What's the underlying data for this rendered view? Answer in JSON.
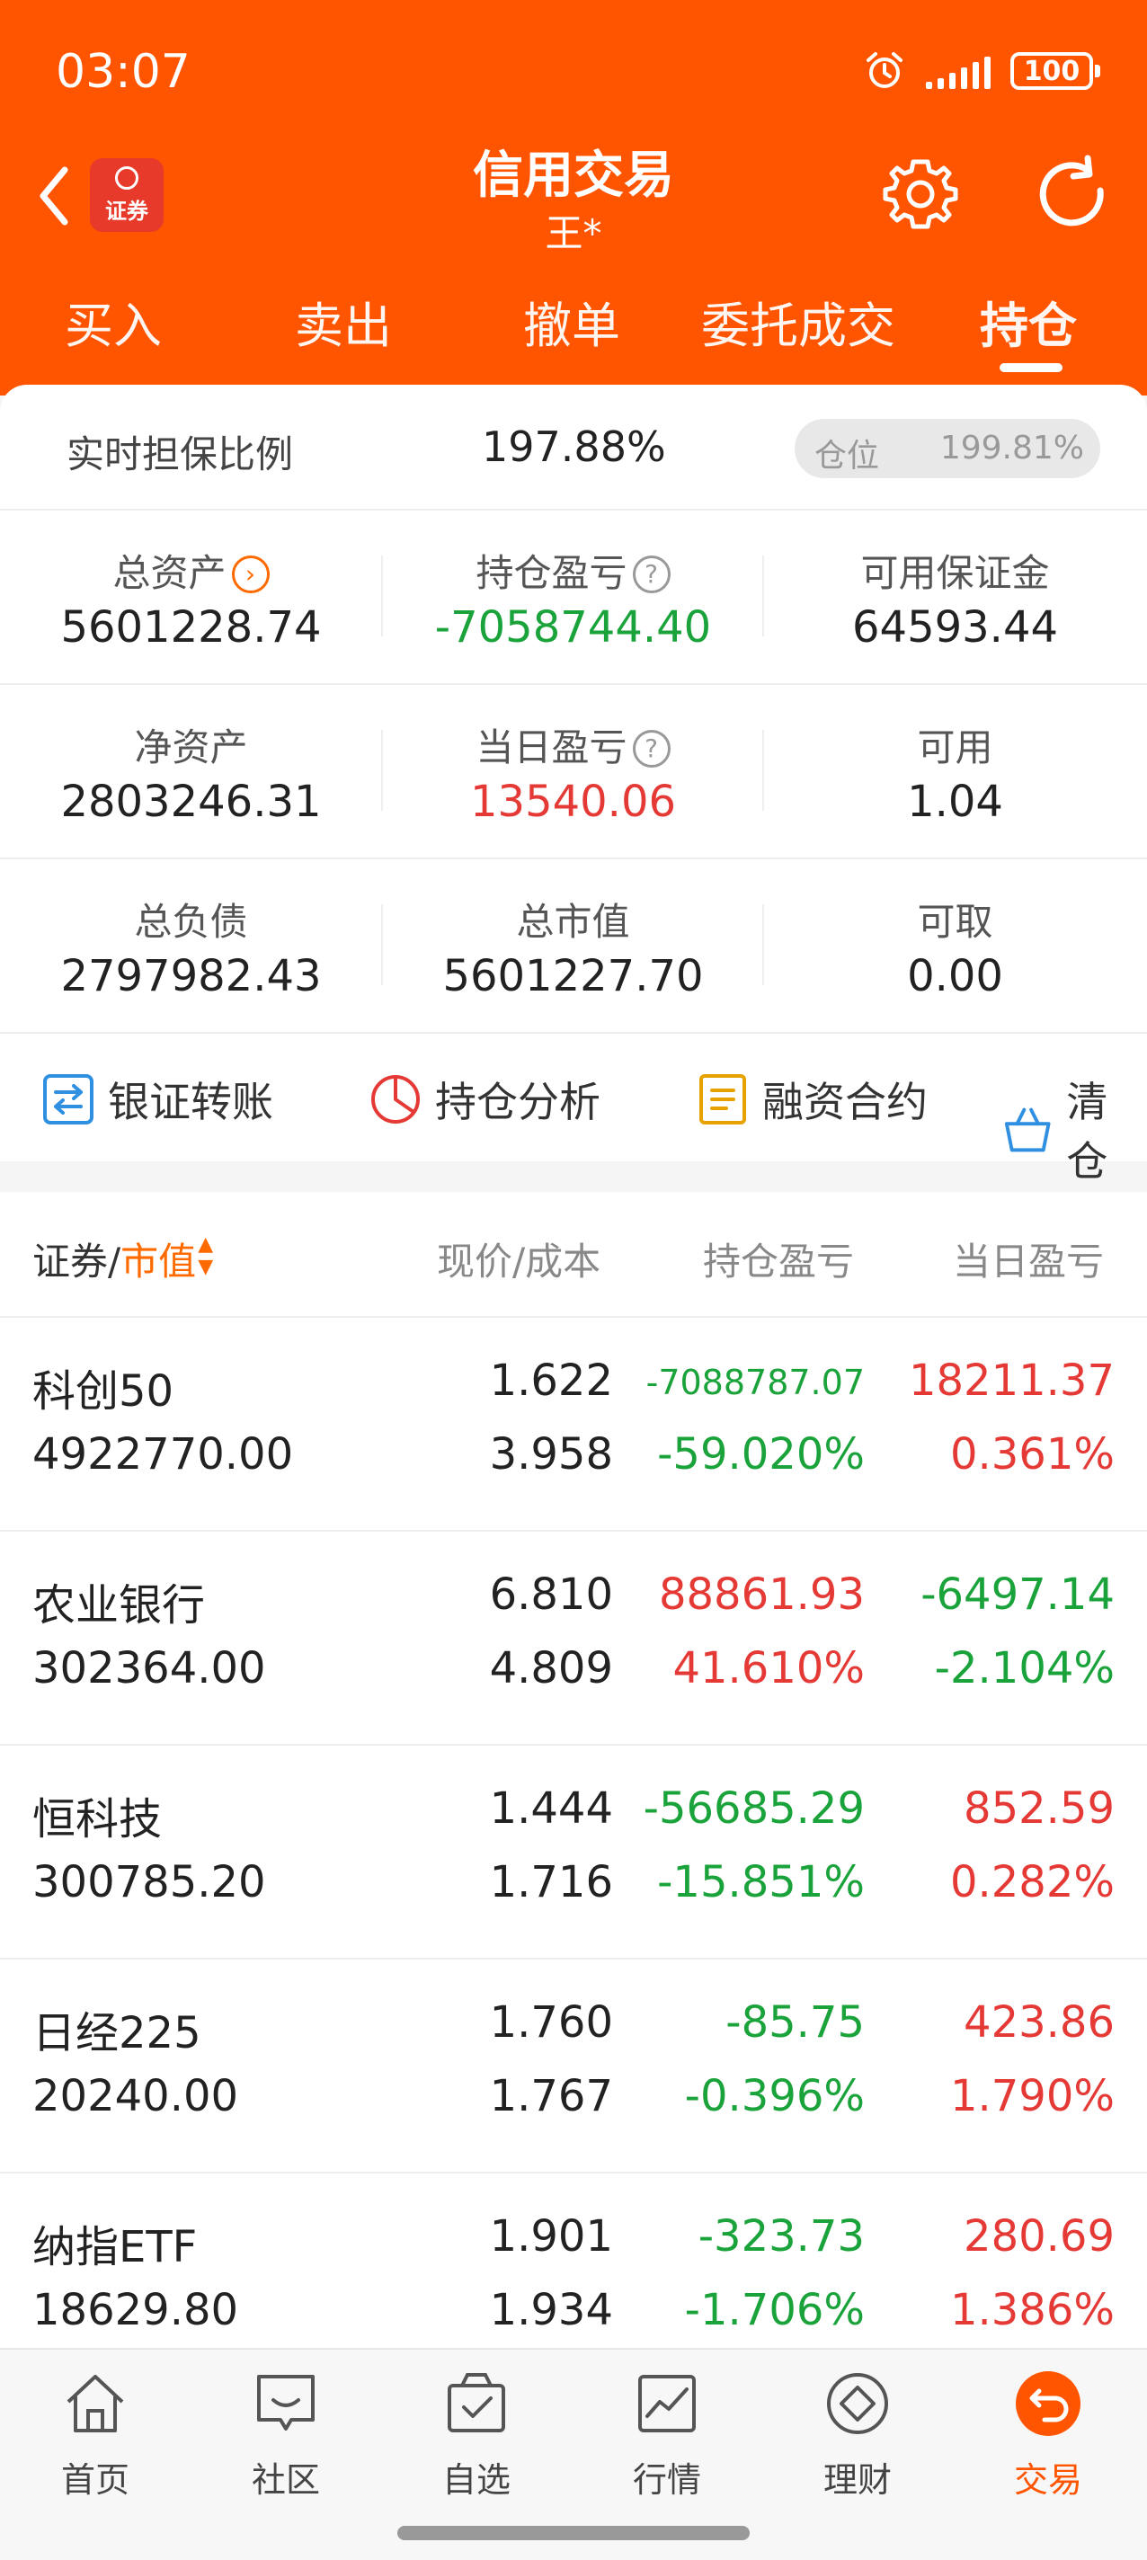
{
  "status": {
    "time": "03:07",
    "battery": "100"
  },
  "header": {
    "brand_label": "证券",
    "title": "信用交易",
    "subtitle": "王*"
  },
  "tabs": [
    {
      "label": "买入"
    },
    {
      "label": "卖出"
    },
    {
      "label": "撤单"
    },
    {
      "label": "委托成交"
    },
    {
      "label": "持仓"
    }
  ],
  "active_tab": "持仓",
  "ratio": {
    "label": "实时担保比例",
    "value": "197.88%",
    "position_label": "仓位",
    "position_value": "199.81%"
  },
  "metrics": [
    [
      {
        "label": "总资产",
        "value": "5601228.74"
      },
      {
        "label": "持仓盈亏",
        "value": "-7058744.40"
      },
      {
        "label": "可用保证金",
        "value": "64593.44"
      }
    ],
    [
      {
        "label": "净资产",
        "value": "2803246.31"
      },
      {
        "label": "当日盈亏",
        "value": "13540.06"
      },
      {
        "label": "可用",
        "value": "1.04"
      }
    ],
    [
      {
        "label": "总负债",
        "value": "2797982.43"
      },
      {
        "label": "总市值",
        "value": "5601227.70"
      },
      {
        "label": "可取",
        "value": "0.00"
      }
    ]
  ],
  "actions": [
    {
      "label": "银证转账"
    },
    {
      "label": "持仓分析"
    },
    {
      "label": "融资合约"
    },
    {
      "label": "清仓"
    }
  ],
  "table": {
    "headers": {
      "security": "证券",
      "slash": "/",
      "market_value": "市值",
      "price_cost": "现价/成本",
      "pl": "持仓盈亏",
      "day_pl": "当日盈亏"
    },
    "rows": [
      {
        "name": "科创50",
        "market_value": "4922770.00",
        "price": "1.622",
        "cost": "3.958",
        "pl": "-7088787.07",
        "pl_pct": "-59.020%",
        "day": "18211.37",
        "day_pct": "0.361%"
      },
      {
        "name": "农业银行",
        "market_value": "302364.00",
        "price": "6.810",
        "cost": "4.809",
        "pl": "88861.93",
        "pl_pct": "41.610%",
        "day": "-6497.14",
        "day_pct": "-2.104%"
      },
      {
        "name": "恒科技",
        "market_value": "300785.20",
        "price": "1.444",
        "cost": "1.716",
        "pl": "-56685.29",
        "pl_pct": "-15.851%",
        "day": "852.59",
        "day_pct": "0.282%"
      },
      {
        "name": "日经225",
        "market_value": "20240.00",
        "price": "1.760",
        "cost": "1.767",
        "pl": "-85.75",
        "pl_pct": "-0.396%",
        "day": "423.86",
        "day_pct": "1.790%"
      },
      {
        "name": "纳指ETF",
        "market_value": "18629.80",
        "price": "1.901",
        "cost": "1.934",
        "pl": "-323.73",
        "pl_pct": "-1.706%",
        "day": "280.69",
        "day_pct": "1.386%"
      }
    ]
  },
  "bottom_nav": [
    {
      "label": "首页",
      "icon": "home-icon"
    },
    {
      "label": "社区",
      "icon": "chat-icon"
    },
    {
      "label": "自选",
      "icon": "check-bag-icon"
    },
    {
      "label": "行情",
      "icon": "chart-icon"
    },
    {
      "label": "理财",
      "icon": "diamond-icon"
    },
    {
      "label": "交易",
      "icon": "trade-icon"
    }
  ],
  "colors": {
    "brand": "#ff5400",
    "up": "#e53935",
    "down": "#1aa33a",
    "accent": "#ff6a00"
  }
}
